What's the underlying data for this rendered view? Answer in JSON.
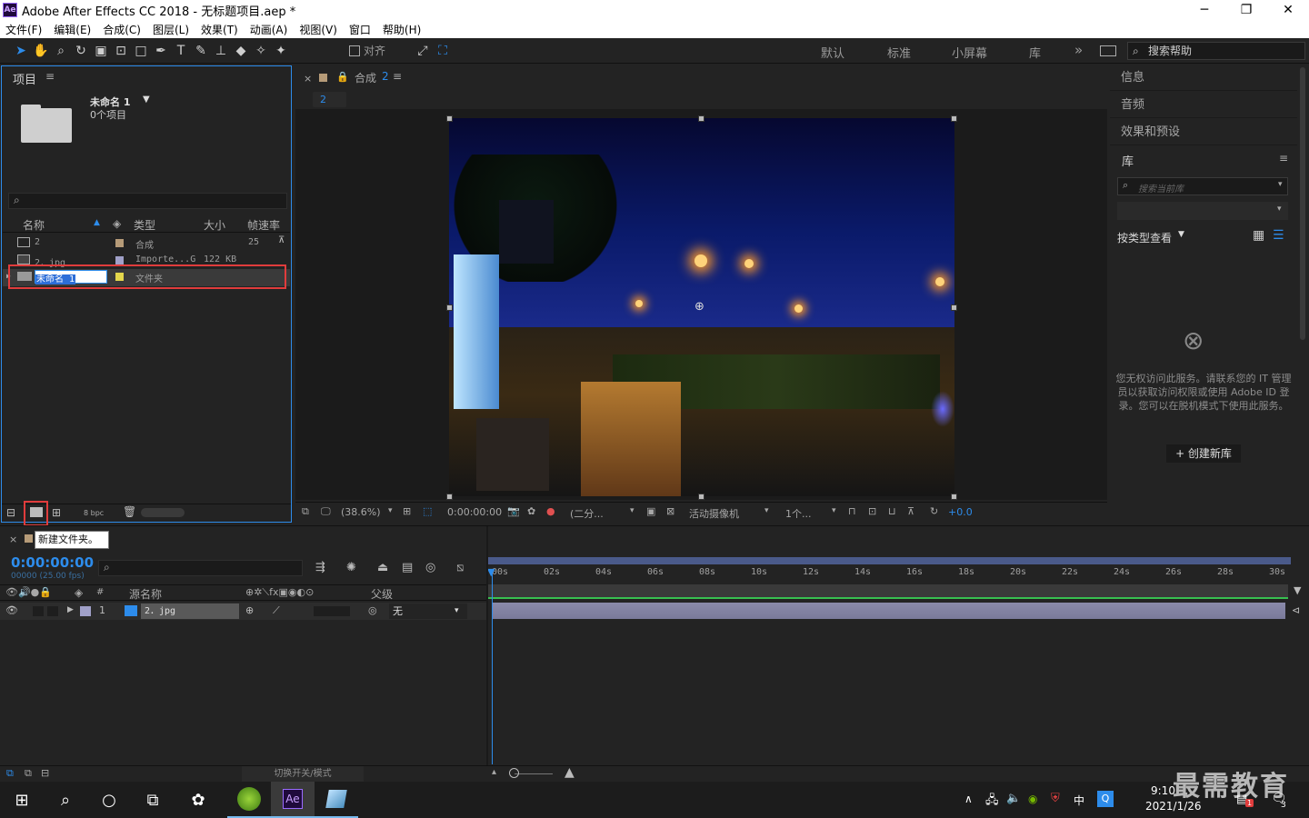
{
  "window": {
    "title": "Adobe After Effects CC 2018 - 无标题项目.aep *",
    "app_badge": "Ae",
    "buttons": {
      "minimize": "─",
      "maximize": "❐",
      "close": "✕"
    }
  },
  "menu": [
    "文件(F)",
    "编辑(E)",
    "合成(C)",
    "图层(L)",
    "效果(T)",
    "动画(A)",
    "视图(V)",
    "窗口",
    "帮助(H)"
  ],
  "toolbar": {
    "align_label": "对齐",
    "workspaces": [
      "默认",
      "标准",
      "小屏幕",
      "库"
    ],
    "overflow": "»",
    "search_help_placeholder": "搜索帮助"
  },
  "project": {
    "panel_title": "项目",
    "folder_name": "未命名 1",
    "folder_count": "0个项目",
    "columns": {
      "name": "名称",
      "type": "类型",
      "size": "大小",
      "fps": "帧速率"
    },
    "rows": [
      {
        "name": "2",
        "type": "合成",
        "size": "",
        "fps": "25",
        "color": "#b69b78"
      },
      {
        "name": "2．jpg",
        "type": "Importe...G",
        "size": "122 KB",
        "fps": "",
        "color": "#a0a0c8"
      },
      {
        "name": "未命名 1",
        "type": "文件夹",
        "size": "",
        "fps": "",
        "color": "#e4d74c"
      }
    ],
    "bpc": "8 bpc",
    "tooltip": "新建文件夹。"
  },
  "comp": {
    "tab_label": "合成",
    "tab_name": "2",
    "breadcrumb": "2",
    "zoom": "(38.6%)",
    "timecode": "0:00:00:00",
    "resolution": "(二分...",
    "camera": "活动摄像机",
    "views": "1个...",
    "exposure": "+0.0"
  },
  "right_panel": {
    "items": [
      "信息",
      "音频",
      "效果和预设"
    ],
    "library_title": "库",
    "library_search_placeholder": "搜索当前库",
    "view_by": "按类型查看",
    "message": "您无权访问此服务。请联系您的 IT 管理员以获取访问权限或使用 Adobe ID 登录。您可以在脱机模式下使用此服务。",
    "create_button": "+ 创建新库"
  },
  "timeline": {
    "timecode": "0:00:00:00",
    "subcode": "00000 (25.00 fps)",
    "columns": {
      "source": "源名称",
      "parent": "父级"
    },
    "layer": {
      "num": "1",
      "name": "2．jpg",
      "parent": "无"
    },
    "ruler": [
      "00s",
      "02s",
      "04s",
      "06s",
      "08s",
      "10s",
      "12s",
      "14s",
      "16s",
      "18s",
      "20s",
      "22s",
      "24s",
      "26s",
      "28s",
      "30s"
    ],
    "toggle_mode": "切换开关/模式"
  },
  "taskbar": {
    "time": "9:10",
    "date": "2021/1/26",
    "ime": "中",
    "notification_count": "3",
    "badge_count": "1",
    "watermark": "最需教育"
  },
  "colors": {
    "accent": "#2d8ceb",
    "highlight_red": "#e03c3c",
    "bg": "#232323"
  }
}
